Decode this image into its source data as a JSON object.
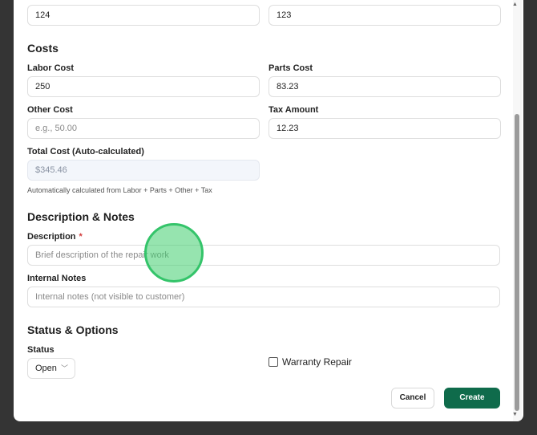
{
  "top_fields": {
    "left_value": "124",
    "right_value": "123"
  },
  "costs": {
    "title": "Costs",
    "labor_cost": {
      "label": "Labor Cost",
      "value": "250"
    },
    "parts_cost": {
      "label": "Parts Cost",
      "value": "83.23"
    },
    "other_cost": {
      "label": "Other Cost",
      "placeholder": "e.g., 50.00"
    },
    "tax_amount": {
      "label": "Tax Amount",
      "value": "12.23"
    },
    "total_cost": {
      "label": "Total Cost (Auto-calculated)",
      "value": "$345.46",
      "helper": "Automatically calculated from Labor + Parts + Other + Tax"
    }
  },
  "description_notes": {
    "title": "Description & Notes",
    "description": {
      "label": "Description",
      "required_marker": "*",
      "placeholder": "Brief description of the repair work"
    },
    "internal_notes": {
      "label": "Internal Notes",
      "placeholder": "Internal notes (not visible to customer)"
    }
  },
  "status_options": {
    "title": "Status & Options",
    "status": {
      "label": "Status",
      "value": "Open",
      "chevron": "﹀"
    },
    "warranty_repair": {
      "label": "Warranty Repair",
      "checked": false
    }
  },
  "actions": {
    "cancel_label": "Cancel",
    "create_label": "Create"
  },
  "scrollbar": {
    "up_arrow": "▲",
    "down_arrow": "▼"
  },
  "icons": {
    "status_chevron": "chevron-down-icon"
  },
  "colors": {
    "primary": "#0f6b4b",
    "required": "#d23b3b",
    "cursor_highlight": "#40cd6e"
  }
}
